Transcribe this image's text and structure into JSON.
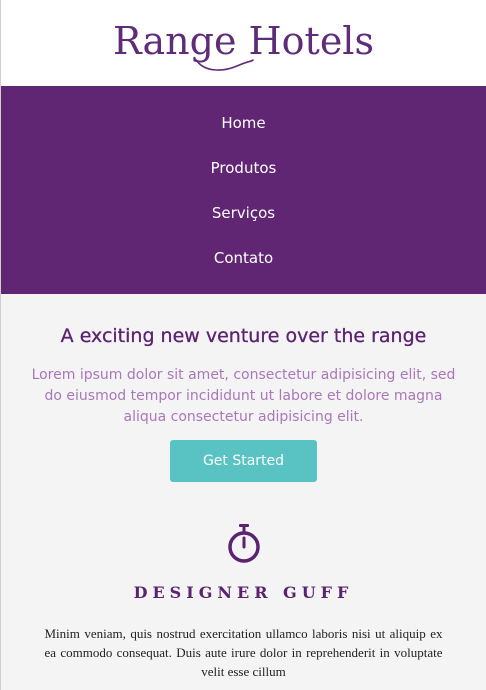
{
  "brand": {
    "name": "Range Hotels",
    "color": "#5f2c79"
  },
  "nav": {
    "background": "#612673",
    "items": [
      {
        "label": "Home"
      },
      {
        "label": "Produtos"
      },
      {
        "label": "Serviços"
      },
      {
        "label": "Contato"
      }
    ]
  },
  "hero": {
    "title": "A exciting new venture over the range",
    "text": "Lorem ipsum dolor sit amet, consectetur adipisicing elit, sed do eiusmod tempor incididunt ut labore et dolore magna aliqua consectetur adipisicing elit.",
    "cta_label": "Get Started",
    "cta_color": "#59c3c3"
  },
  "feature": {
    "icon": "stopwatch-icon",
    "title": "DESIGNER GUFF",
    "text": "Minim veniam, quis nostrud exercitation ullamco laboris nisi ut aliquip ex ea commodo consequat. Duis aute irure dolor in reprehenderit in voluptate velit esse cillum"
  }
}
